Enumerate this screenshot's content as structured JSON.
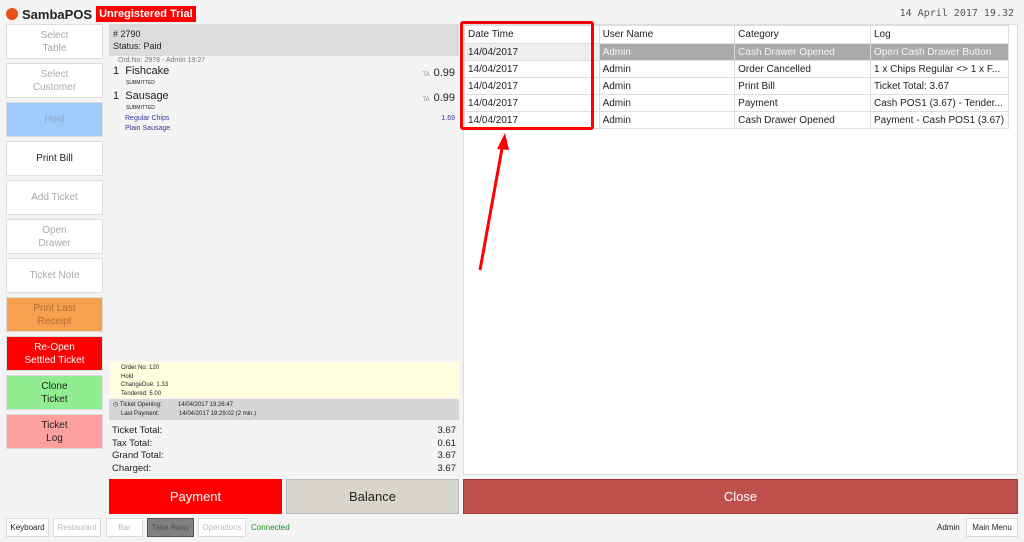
{
  "header": {
    "brand": "SambaPOS",
    "trial_badge": "Unregistered Trial",
    "datetime": "14 April 2017 19.32"
  },
  "left_buttons": [
    {
      "label": "Select\nTable",
      "bg": "#ffffff",
      "color": "#aaaaaa"
    },
    {
      "label": "Select\nCustomer",
      "bg": "#ffffff",
      "color": "#aaaaaa"
    },
    {
      "label": "Hold",
      "bg": "#9fcbfb",
      "color": "#8aa6c6"
    },
    {
      "label": "Print Bill",
      "bg": "#ffffff",
      "color": "#222222"
    },
    {
      "label": "Add Ticket",
      "bg": "#ffffff",
      "color": "#aaaaaa"
    },
    {
      "label": "Open\nDrawer",
      "bg": "#ffffff",
      "color": "#aaaaaa"
    },
    {
      "label": "Ticket Note",
      "bg": "#ffffff",
      "color": "#aaaaaa"
    },
    {
      "label": "Print Last\nReceipt",
      "bg": "#f7a04f",
      "color": "#b06a30"
    },
    {
      "label": "Re-Open\nSettled Ticket",
      "bg": "#ff0000",
      "color": "#ffffff"
    },
    {
      "label": "Clone\nTicket",
      "bg": "#90ee90",
      "color": "#222222"
    },
    {
      "label": "Ticket\nLog",
      "bg": "#ffa0a0",
      "color": "#222222"
    }
  ],
  "ticket": {
    "number": "# 2790",
    "status": "Status: Paid",
    "order_info": "Ord.No: 2978 - Admin  19:27",
    "items": [
      {
        "qty": "1",
        "name": "Fishcake",
        "state": "SUBMITTED",
        "tag": "TA",
        "price": "0.99"
      },
      {
        "qty": "1",
        "name": "Sausage",
        "state": "SUBMITTED",
        "tag": "TA",
        "price": "0.99"
      }
    ],
    "modifiers": [
      {
        "name": "Regular Chips",
        "price": "1.69"
      },
      {
        "name": "Plain Sausage",
        "price": ""
      }
    ],
    "notes": [
      "Order No: 120",
      "Hold",
      "ChangeDue: 1.33",
      "Tendered: 5.00"
    ],
    "opening_label": "Ticket Opening:",
    "opening_value": "14/04/2017 19:26:47",
    "payment_label": "Last Payment:",
    "payment_value": "14/04/2017 19:29:02 (2 min.)",
    "totals": [
      {
        "label": "Ticket Total:",
        "value": "3.67"
      },
      {
        "label": "Tax Total:",
        "value": "0.61"
      },
      {
        "label": "Grand Total:",
        "value": "3.67"
      },
      {
        "label": "Charged:",
        "value": "3.67"
      }
    ]
  },
  "log": {
    "columns": [
      "Date Time",
      "User Name",
      "Category",
      "Log"
    ],
    "rows": [
      [
        "14/04/2017",
        "Admin",
        "Cash Drawer Opened",
        "Open Cash Drawer Button"
      ],
      [
        "14/04/2017",
        "Admin",
        "Order Cancelled",
        "1 x Chips Regular <> 1 x F..."
      ],
      [
        "14/04/2017",
        "Admin",
        "Print Bill",
        "Ticket Total: 3.67"
      ],
      [
        "14/04/2017",
        "Admin",
        "Payment",
        "Cash POS1 (3.67) - Tender..."
      ],
      [
        "14/04/2017",
        "Admin",
        "Cash Drawer Opened",
        "Payment - Cash POS1 (3.67)"
      ]
    ]
  },
  "actions": {
    "payment": "Payment",
    "balance": "Balance",
    "close": "Close"
  },
  "footer": {
    "buttons": [
      "Keyboard",
      "Restaurant",
      "Bar",
      "Take Away",
      "Operations"
    ],
    "status": "Connected",
    "user": "Admin",
    "main_menu": "Main Menu"
  }
}
